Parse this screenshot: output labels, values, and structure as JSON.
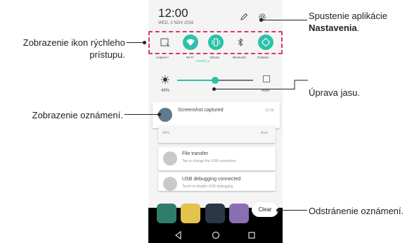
{
  "status": {
    "time": "12:00",
    "date": "WED, 2 NOV 2016"
  },
  "quick_settings": {
    "labels": [
      "Capture+",
      "Wi-Fi",
      "Vibrate",
      "Bluetooth",
      "Rotation"
    ],
    "wifi_network": "mowifi_m"
  },
  "brightness": {
    "percent": "49%",
    "auto_label": "Auto",
    "level": 0.5
  },
  "notifications": {
    "screenshot": {
      "title": "Screenshot captured",
      "time": "12:00"
    },
    "brightness_row": {
      "percent": "49%",
      "auto": "Auto"
    },
    "file_transfer": {
      "title": "File transfer",
      "subtitle": "Tap to change the USB connection"
    },
    "usb_debugging": {
      "title": "USB debugging connected",
      "subtitle": "Touch to disable USB debugging"
    }
  },
  "clear_label": "Clear",
  "callouts": {
    "settings_line1": "Spustenie aplikácie",
    "settings_bold": "Nastavenia",
    "settings_end": ".",
    "quick_access": "Zobrazenie ikon rýchleho prístupu.",
    "brightness": "Úprava jasu.",
    "notifications": "Zobrazenie oznámení.",
    "clear": "Odstránenie oznámení."
  },
  "colors": {
    "accent": "#2cc1a8",
    "highlight_box": "#d63a6d"
  }
}
